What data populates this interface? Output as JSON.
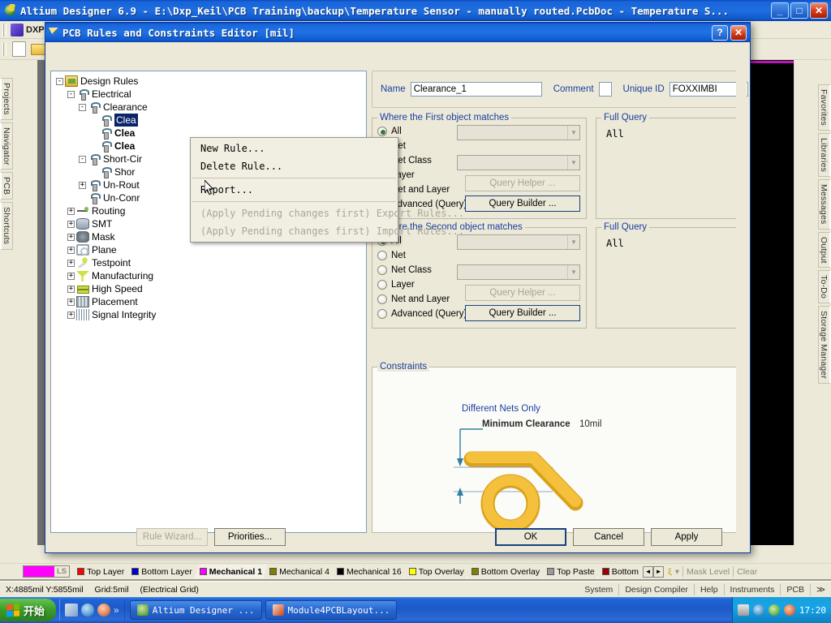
{
  "app": {
    "title": "Altium Designer 6.9 - E:\\Dxp_Keil\\PCB Training\\backup\\Temperature Sensor - manually routed.PcbDoc - Temperature S...",
    "minimize": "_",
    "maximize": "□",
    "close": "✕",
    "dxp_label": "DXP"
  },
  "left_dock": {
    "tabs": [
      "Projects",
      "Navigator",
      "PCB",
      "Shortcuts"
    ]
  },
  "right_dock": {
    "tabs": [
      "Favorites",
      "Libraries",
      "Messages",
      "Output",
      "To-Do",
      "Storage Manager"
    ]
  },
  "dialog": {
    "title": "PCB Rules and Constraints Editor [mil]",
    "help_label": "?",
    "close_label": "✕",
    "tree": [
      {
        "label": "Design Rules",
        "depth": 0,
        "expander": "-",
        "icon": "design-rules-icon",
        "bold": false,
        "selected": false
      },
      {
        "label": "Electrical",
        "depth": 1,
        "expander": "-",
        "icon": "electrical-icon",
        "bold": false,
        "selected": false
      },
      {
        "label": "Clearance",
        "depth": 2,
        "expander": "-",
        "icon": "electrical-icon",
        "bold": false,
        "selected": false
      },
      {
        "label": "Clea",
        "depth": 3,
        "expander": "",
        "icon": "electrical-icon",
        "bold": false,
        "selected": true
      },
      {
        "label": "Clea",
        "depth": 3,
        "expander": "",
        "icon": "electrical-icon",
        "bold": true,
        "selected": false
      },
      {
        "label": "Clea",
        "depth": 3,
        "expander": "",
        "icon": "electrical-icon",
        "bold": true,
        "selected": false
      },
      {
        "label": "Short-Cir",
        "depth": 2,
        "expander": "-",
        "icon": "electrical-icon",
        "bold": false,
        "selected": false
      },
      {
        "label": "Shor",
        "depth": 3,
        "expander": "",
        "icon": "electrical-icon",
        "bold": false,
        "selected": false
      },
      {
        "label": "Un-Rout",
        "depth": 2,
        "expander": "+",
        "icon": "electrical-icon",
        "bold": false,
        "selected": false
      },
      {
        "label": "Un-Conr",
        "depth": 2,
        "expander": "",
        "icon": "electrical-icon",
        "bold": false,
        "selected": false
      },
      {
        "label": "Routing",
        "depth": 1,
        "expander": "+",
        "icon": "routing-icon",
        "bold": false,
        "selected": false
      },
      {
        "label": "SMT",
        "depth": 1,
        "expander": "+",
        "icon": "smt-icon",
        "bold": false,
        "selected": false
      },
      {
        "label": "Mask",
        "depth": 1,
        "expander": "+",
        "icon": "mask-icon",
        "bold": false,
        "selected": false
      },
      {
        "label": "Plane",
        "depth": 1,
        "expander": "+",
        "icon": "plane-icon",
        "bold": false,
        "selected": false
      },
      {
        "label": "Testpoint",
        "depth": 1,
        "expander": "+",
        "icon": "testpoint-icon",
        "bold": false,
        "selected": false
      },
      {
        "label": "Manufacturing",
        "depth": 1,
        "expander": "+",
        "icon": "manufacturing-icon",
        "bold": false,
        "selected": false
      },
      {
        "label": "High Speed",
        "depth": 1,
        "expander": "+",
        "icon": "high-speed-icon",
        "bold": false,
        "selected": false
      },
      {
        "label": "Placement",
        "depth": 1,
        "expander": "+",
        "icon": "placement-icon",
        "bold": false,
        "selected": false
      },
      {
        "label": "Signal Integrity",
        "depth": 1,
        "expander": "+",
        "icon": "signal-integrity-icon",
        "bold": false,
        "selected": false
      }
    ],
    "context_menu": [
      {
        "label": "New Rule...",
        "disabled": false,
        "separator_after": false
      },
      {
        "label": "Delete Rule...",
        "disabled": false,
        "separator_after": true
      },
      {
        "label": "Report...",
        "disabled": false,
        "separator_after": true
      },
      {
        "label": "(Apply Pending changes first) Export Rules...",
        "disabled": true,
        "separator_after": false
      },
      {
        "label": "(Apply Pending changes first) Import Rules...",
        "disabled": true,
        "separator_after": false
      }
    ],
    "name_row": {
      "name_label": "Name",
      "name_value": "Clearance_1",
      "comment_label": "Comment",
      "comment_value": "",
      "unique_id_label": "Unique ID",
      "unique_id_value": "FOXXIMBI"
    },
    "first_match": {
      "title": "Where the First object matches",
      "options": [
        "All",
        "Net",
        "Net Class",
        "Layer",
        "Net and Layer",
        "Advanced (Query)"
      ],
      "selected": "All",
      "query_helper_label": "Query Helper ...",
      "query_builder_label": "Query Builder ..."
    },
    "second_match": {
      "title": "Where the Second object matches",
      "options": [
        "All",
        "Net",
        "Net Class",
        "Layer",
        "Net and Layer",
        "Advanced (Query)"
      ],
      "selected": "All",
      "query_helper_label": "Query Helper ...",
      "query_builder_label": "Query Builder ..."
    },
    "full_query_first": {
      "title": "Full Query",
      "value": "All"
    },
    "full_query_second": {
      "title": "Full Query",
      "value": "All"
    },
    "constraints": {
      "title": "Constraints",
      "different_nets_label": "Different Nets Only",
      "minimum_clearance_label": "Minimum Clearance",
      "minimum_clearance_value": "10mil"
    },
    "footer": {
      "rule_wizard": "Rule Wizard...",
      "priorities": "Priorities...",
      "ok": "OK",
      "cancel": "Cancel",
      "apply": "Apply"
    }
  },
  "layer_bar": {
    "ls_label": "LS",
    "ls_color": "#ff00ff",
    "tabs": [
      {
        "label": "Top Layer",
        "color": "#ff0000",
        "active": false
      },
      {
        "label": "Bottom Layer",
        "color": "#0000cc",
        "active": false
      },
      {
        "label": "Mechanical 1",
        "color": "#ff00ff",
        "active": true
      },
      {
        "label": "Mechanical 4",
        "color": "#808000",
        "active": false
      },
      {
        "label": "Mechanical 16",
        "color": "#000000",
        "active": false
      },
      {
        "label": "Top Overlay",
        "color": "#ffff00",
        "active": false
      },
      {
        "label": "Bottom Overlay",
        "color": "#808000",
        "active": false
      },
      {
        "label": "Top Paste",
        "color": "#999999",
        "active": false
      },
      {
        "label": "Bottom",
        "color": "#990000",
        "active": false
      }
    ],
    "mask_level": "Mask Level",
    "clear": "Clear"
  },
  "status_bar": {
    "coords": "X:4885mil Y:5855mil",
    "grid": "Grid:5mil",
    "grid_mode": "(Electrical Grid)",
    "buttons": [
      "System",
      "Design Compiler",
      "Help",
      "Instruments",
      "PCB"
    ],
    "overflow": "≫"
  },
  "taskbar": {
    "start_label": "开始",
    "items": [
      "Altium Designer ...",
      "Module4PCBLayout..."
    ],
    "clock": "17:20"
  }
}
